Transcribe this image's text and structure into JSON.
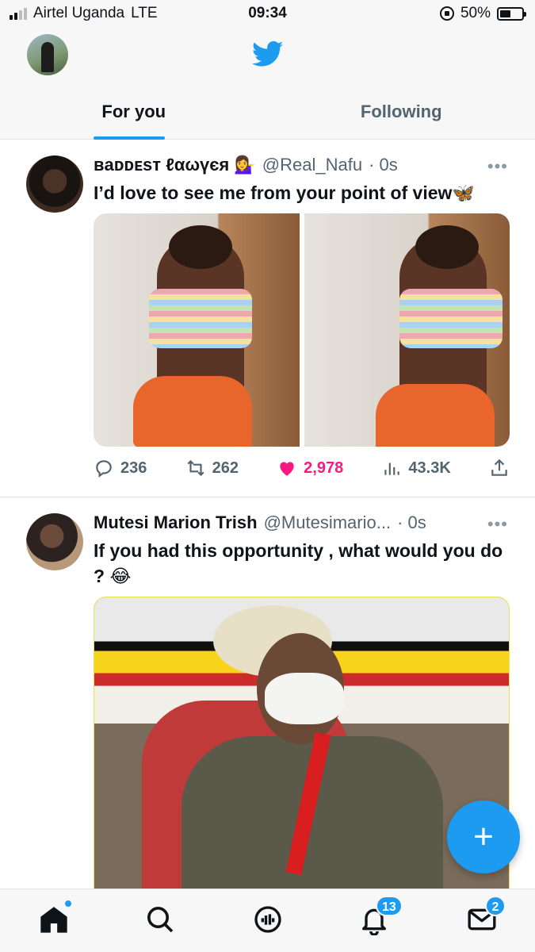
{
  "status_bar": {
    "carrier": "Airtel Uganda",
    "network": "LTE",
    "time": "09:34",
    "battery": "50%",
    "battery_level": 0.5
  },
  "header": {
    "logo_icon": "twitter-bird-icon",
    "tabs": [
      {
        "label": "For you",
        "active": true
      },
      {
        "label": "Following",
        "active": false
      }
    ]
  },
  "tweets": [
    {
      "name": "ʙaᴅᴅᴇsᴛ ℓαωүєя 💁‍♀️",
      "handle": "@Real_Nafu",
      "time": "· 0s",
      "text": "I’d love to see me from your point of view🦋",
      "replies": "236",
      "retweets": "262",
      "likes": "2,978",
      "views": "43.3K",
      "liked": true
    },
    {
      "name": "Mutesi Marion Trish",
      "handle": "@Mutesimario...",
      "time": "· 0s",
      "text": "If you had this opportunity , what would you do ? 😂"
    }
  ],
  "more_label": "•••",
  "fab_label": "+",
  "bottom_nav": {
    "items": [
      "home-icon",
      "search-icon",
      "spaces-icon",
      "notifications-icon",
      "messages-icon"
    ],
    "notifications_badge": "13",
    "messages_badge": "2"
  },
  "colors": {
    "accent": "#1d9bf0",
    "like": "#f91880",
    "text": "#0f1419",
    "secondary": "#536471"
  }
}
